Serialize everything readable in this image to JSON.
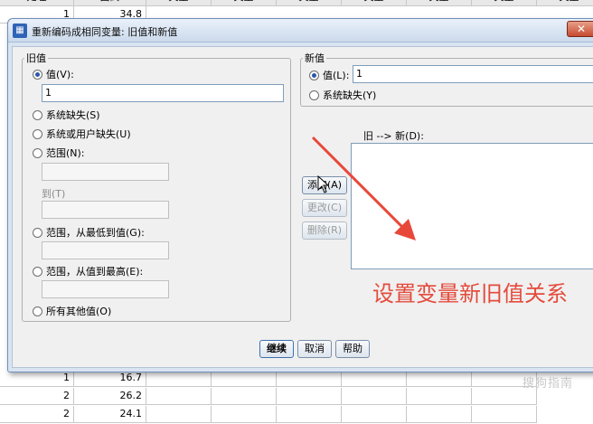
{
  "spreadsheet": {
    "top_cells": [
      {
        "col": "A",
        "value": "1"
      },
      {
        "col": "B",
        "value": "34.8"
      }
    ],
    "bottom_rows": [
      [
        "1",
        "16.7"
      ],
      [
        "2",
        "26.2"
      ],
      [
        "2",
        "24.1"
      ]
    ],
    "header_fragments": [
      "处理",
      "面高",
      "文里",
      "文里",
      "文里",
      "文里",
      "文里",
      "文里",
      "文里"
    ]
  },
  "watermark": "搜狗指南",
  "dialog": {
    "title": "重新编码成相同变量: 旧值和新值",
    "close_label": "✕",
    "old_value": {
      "legend": "旧值",
      "value_label": "值(V):",
      "value_input": "1",
      "system_missing": "系统缺失(S)",
      "system_or_user_missing": "系统或用户缺失(U)",
      "range": "范围(N):",
      "to_label": "到(T)",
      "range_lowest": "范围，从最低到值(G):",
      "range_highest": "范围，从值到最高(E):",
      "all_other": "所有其他值(O)"
    },
    "new_value": {
      "legend": "新值",
      "value_label": "值(L):",
      "value_input": "1",
      "system_missing": "系统缺失(Y)"
    },
    "old_new_label": "旧 --> 新(D):",
    "buttons": {
      "add": "添加(A)",
      "change": "更改(C)",
      "remove": "删除(R)",
      "continue": "继续",
      "cancel": "取消",
      "help": "帮助"
    }
  },
  "annotation": "设置变量新旧值关系",
  "colors": {
    "annotation": "#e44b3c",
    "arrow": "#e8483a",
    "dialog_frame": "#d9e4f1"
  }
}
